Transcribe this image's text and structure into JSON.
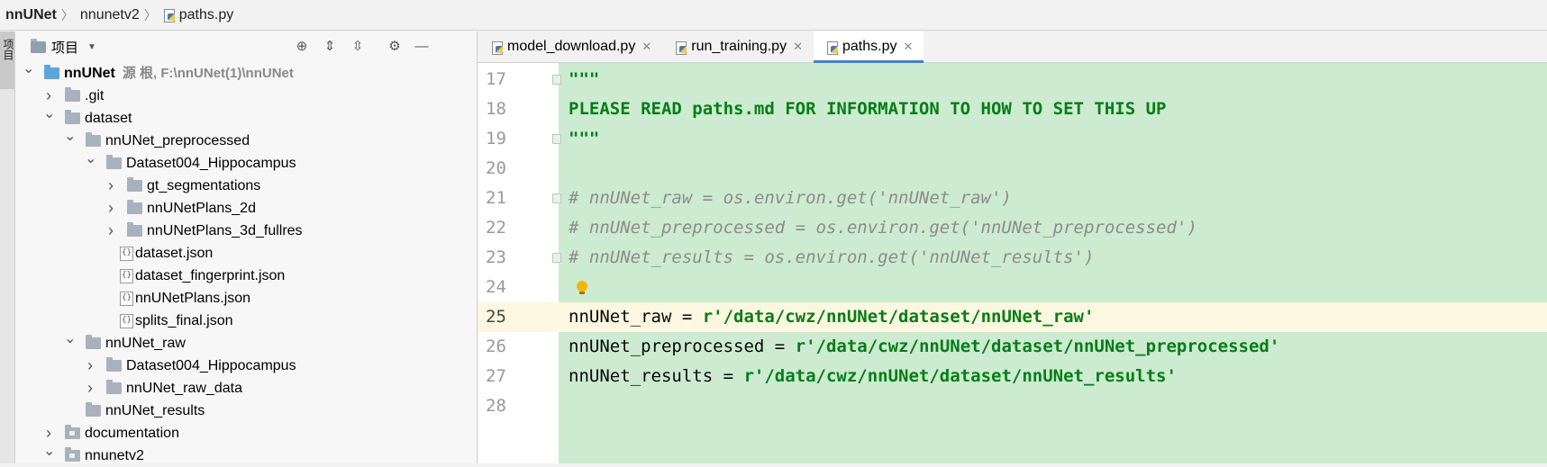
{
  "breadcrumb": {
    "project": "nnUNet",
    "folder": "nnunetv2",
    "file": "paths.py"
  },
  "left_strip": {
    "tab_label": "项目"
  },
  "project_panel": {
    "title": "项目",
    "tree": [
      {
        "label": "nnUNet",
        "hint": "源 根, F:\\nnUNet(1)\\nnUNet",
        "type": "root-folder",
        "expanded": true
      },
      {
        "label": ".git",
        "type": "folder",
        "expanded": false
      },
      {
        "label": "dataset",
        "type": "folder",
        "expanded": true
      },
      {
        "label": "nnUNet_preprocessed",
        "type": "folder",
        "expanded": true
      },
      {
        "label": "Dataset004_Hippocampus",
        "type": "folder",
        "expanded": true
      },
      {
        "label": "gt_segmentations",
        "type": "folder",
        "expanded": false
      },
      {
        "label": "nnUNetPlans_2d",
        "type": "folder",
        "expanded": false
      },
      {
        "label": "nnUNetPlans_3d_fullres",
        "type": "folder",
        "expanded": false
      },
      {
        "label": "dataset.json",
        "type": "json"
      },
      {
        "label": "dataset_fingerprint.json",
        "type": "json"
      },
      {
        "label": "nnUNetPlans.json",
        "type": "json"
      },
      {
        "label": "splits_final.json",
        "type": "json"
      },
      {
        "label": "nnUNet_raw",
        "type": "folder",
        "expanded": true
      },
      {
        "label": "Dataset004_Hippocampus",
        "type": "folder",
        "expanded": false
      },
      {
        "label": "nnUNet_raw_data",
        "type": "folder",
        "expanded": false
      },
      {
        "label": "nnUNet_results",
        "type": "folder"
      },
      {
        "label": "documentation",
        "type": "package",
        "expanded": false
      },
      {
        "label": "nnunetv2",
        "type": "package",
        "expanded": true
      }
    ]
  },
  "tabs": [
    {
      "label": "model_download.py",
      "active": false
    },
    {
      "label": "run_training.py",
      "active": false
    },
    {
      "label": "paths.py",
      "active": true
    }
  ],
  "editor": {
    "lines": [
      {
        "n": "17",
        "text": "\"\"\""
      },
      {
        "n": "18",
        "text": "PLEASE READ paths.md FOR INFORMATION TO HOW TO SET THIS UP"
      },
      {
        "n": "19",
        "text": "\"\"\""
      },
      {
        "n": "20",
        "text": ""
      },
      {
        "n": "21",
        "text": "# nnUNet_raw = os.environ.get('nnUNet_raw')"
      },
      {
        "n": "22",
        "text": "# nnUNet_preprocessed = os.environ.get('nnUNet_preprocessed')"
      },
      {
        "n": "23",
        "text": "# nnUNet_results = os.environ.get('nnUNet_results')"
      },
      {
        "n": "24",
        "text": ""
      },
      {
        "n": "25",
        "lhs": "nnUNet_raw = ",
        "rhs": "r'/data/cwz/nnUNet/dataset/nnUNet_raw'"
      },
      {
        "n": "26",
        "lhs": "nnUNet_preprocessed = ",
        "rhs": "r'/data/cwz/nnUNet/dataset/nnUNet_preprocessed'"
      },
      {
        "n": "27",
        "lhs": "nnUNet_results = ",
        "rhs": "r'/data/cwz/nnUNet/dataset/nnUNet_results'"
      },
      {
        "n": "28",
        "text": ""
      }
    ]
  },
  "colors": {
    "string": "#067d17",
    "comment": "#8c8c8c",
    "code_bg": "#ccebd0",
    "current_line": "#fcf7e0",
    "tab_underline": "#4083c9"
  }
}
